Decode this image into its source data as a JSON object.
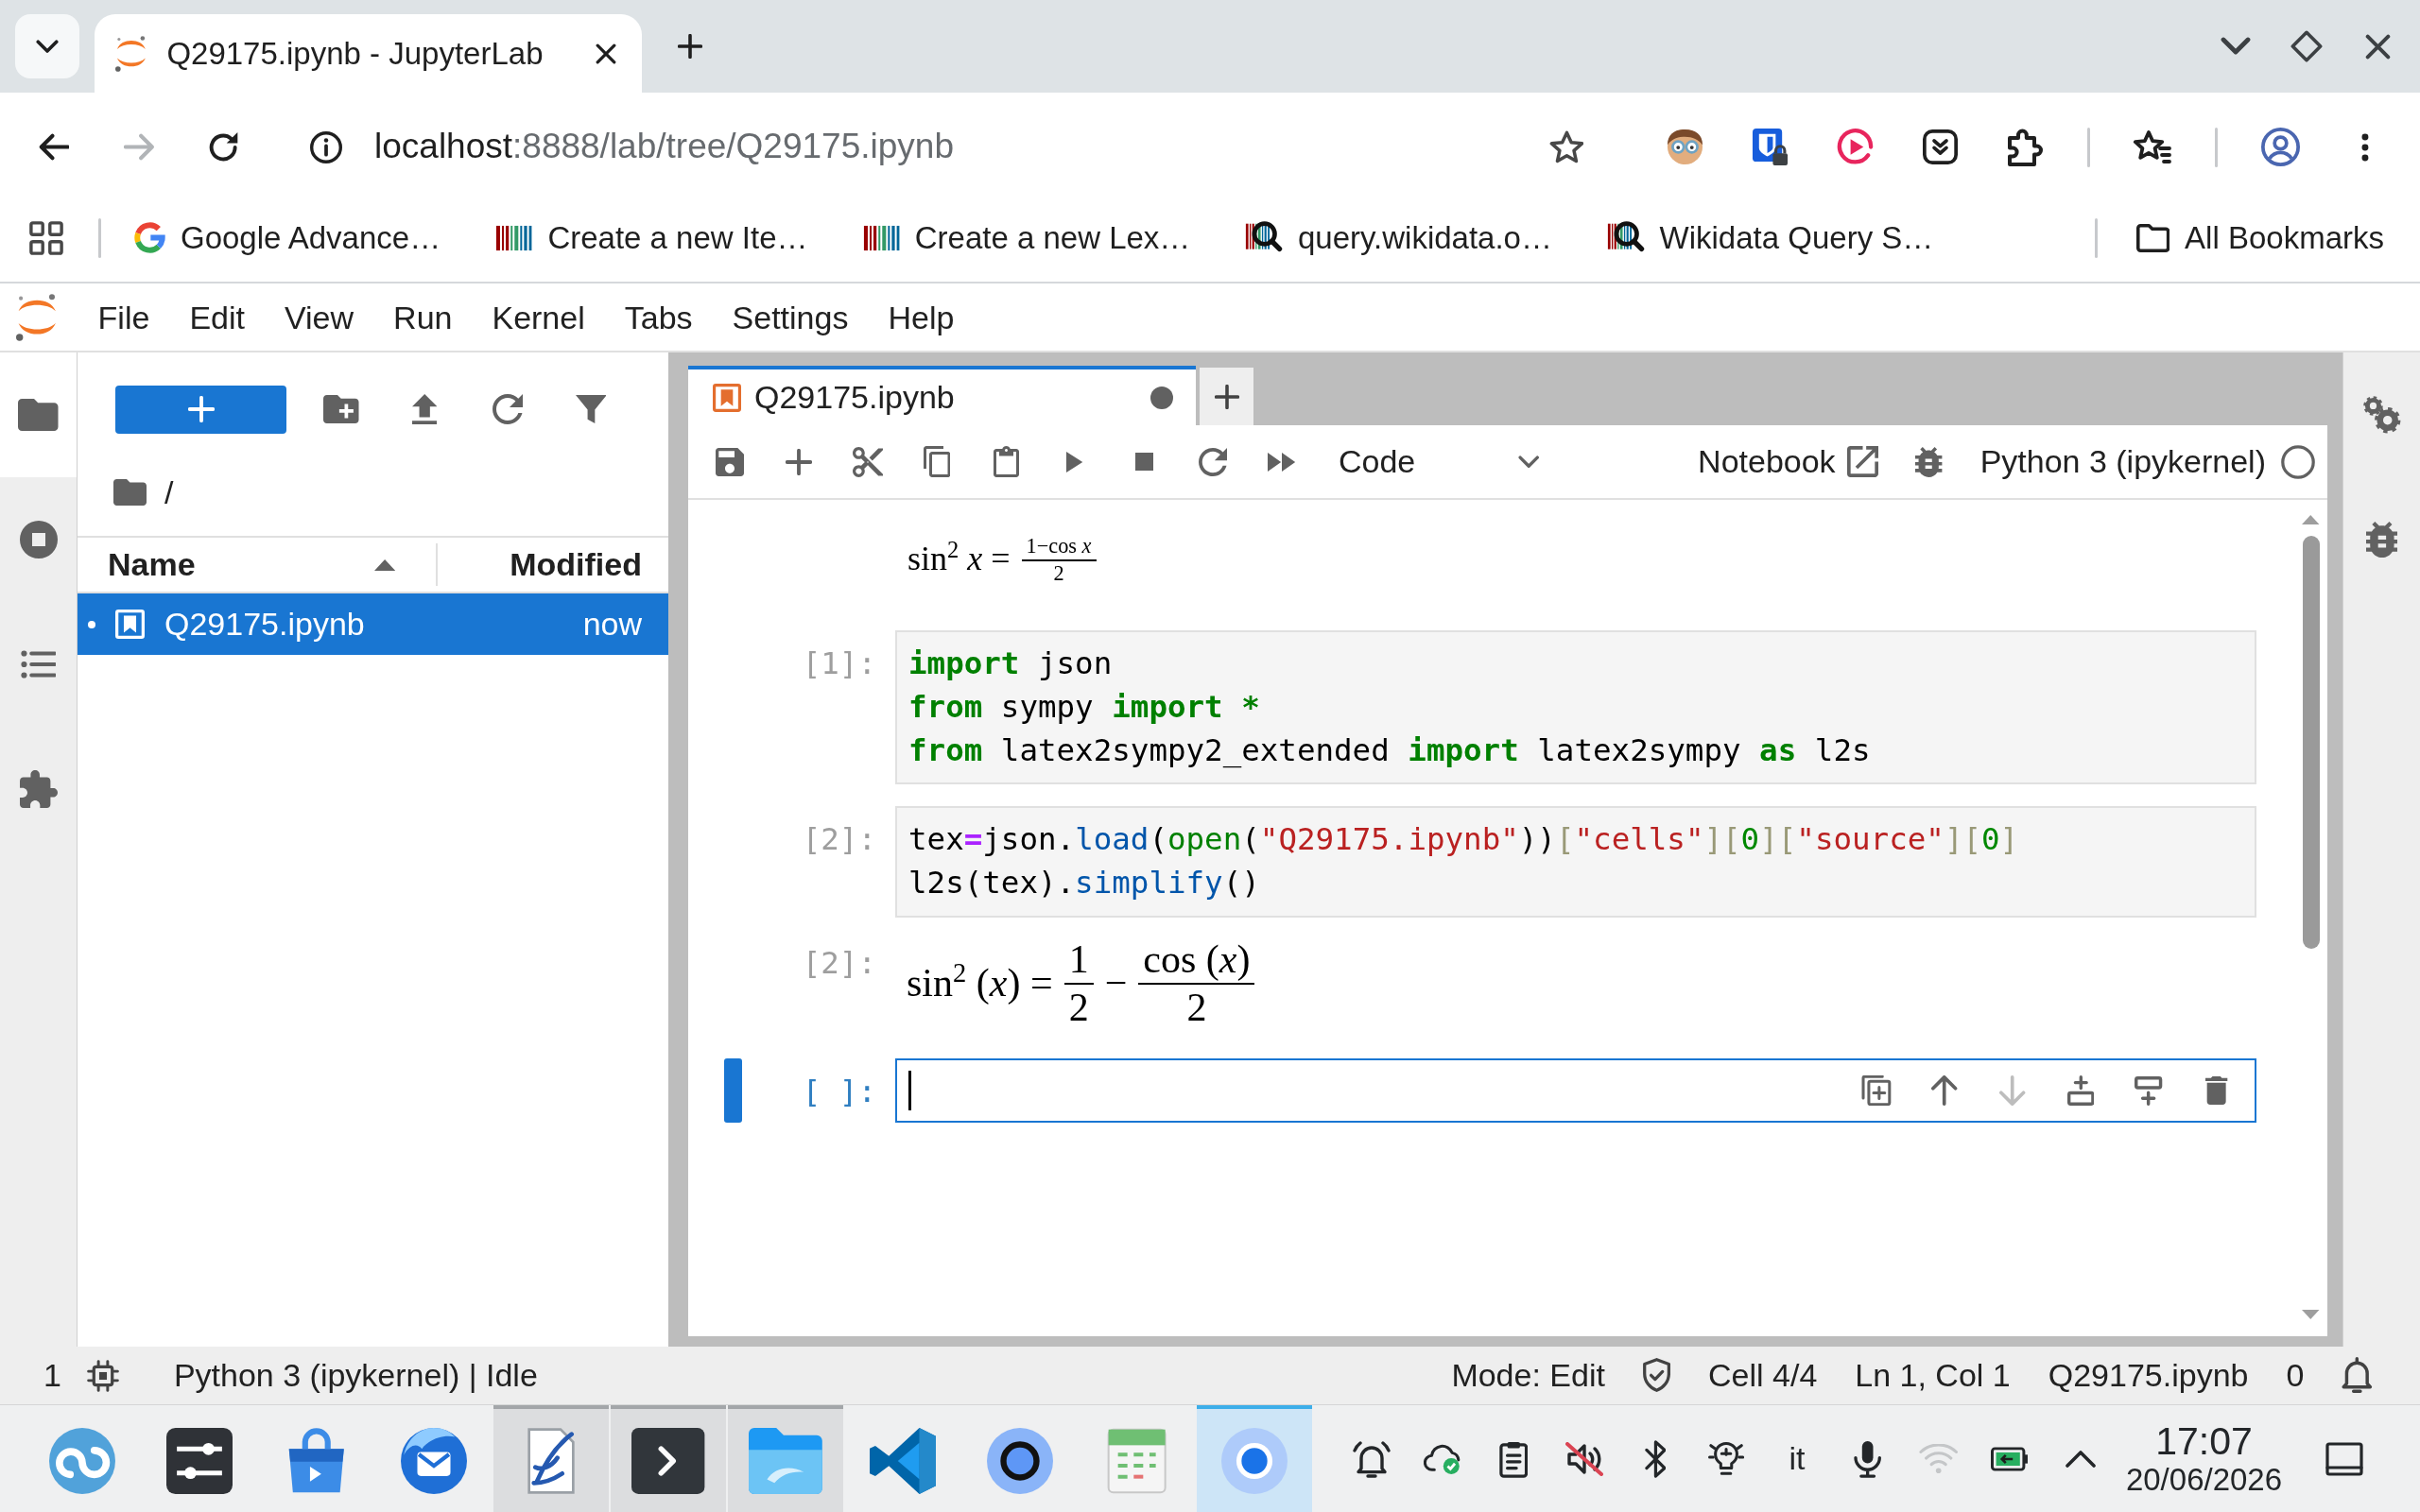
{
  "browser": {
    "tabs": [
      {
        "title": "Q29175.ipynb - JupyterLab",
        "selected": true
      }
    ],
    "nav": [
      {
        "kind": "back",
        "disabled": false
      },
      {
        "kind": "forward",
        "disabled": true
      }
    ],
    "address": {
      "host": "localhost",
      "path": ":8888/lab/tree/Q29175.ipynb"
    },
    "bookmarks": [
      {
        "kind": "google",
        "label": "Google Advance…"
      },
      {
        "kind": "wikidata",
        "label": "Create a new Ite…"
      },
      {
        "kind": "wikidata",
        "label": "Create a new Lex…"
      },
      {
        "kind": "query",
        "label": "query.wikidata.o…"
      },
      {
        "kind": "query",
        "label": "Wikidata Query S…"
      }
    ],
    "all_bookmarks": "All Bookmarks"
  },
  "jupyterlab": {
    "menu": [
      "File",
      "Edit",
      "View",
      "Run",
      "Kernel",
      "Tabs",
      "Settings",
      "Help"
    ],
    "left_sidebar": [
      {
        "kind": "files",
        "selected": true
      },
      {
        "kind": "running",
        "selected": false
      },
      {
        "kind": "toc",
        "selected": false
      },
      {
        "kind": "extensions",
        "selected": false
      }
    ],
    "file_browser": {
      "path": "/",
      "columns": [
        {
          "label": "Name",
          "sorted": true,
          "ascending": true
        },
        {
          "label": "Modified",
          "sorted": false
        }
      ],
      "files": [
        {
          "name": "Q29175.ipynb",
          "modified": "now",
          "selected": true,
          "running": true
        }
      ]
    },
    "notebook": {
      "tabs": [
        {
          "title": "Q29175.ipynb",
          "selected": true,
          "dirty": true
        }
      ],
      "cell_type": "Code",
      "view_button": "Notebook",
      "kernel": {
        "name": "Python 3 (ipykernel)",
        "busy": false
      },
      "cells": [
        {
          "kind": "markdown",
          "active": false,
          "math": [
            {
              "kind": "text",
              "text": "sin$^{2}$ *x* ="
            },
            {
              "kind": "inline_fraction",
              "numerator": "1−cos *x*",
              "denominator": "2"
            }
          ]
        },
        {
          "kind": "code",
          "active": false,
          "prompt": "[1]:",
          "lines": [
            [
              {
                "text": "import",
                "kind": "keyword"
              },
              {
                "text": " json",
                "kind": "plain"
              }
            ],
            [
              {
                "text": "from",
                "kind": "keyword"
              },
              {
                "text": " sympy ",
                "kind": "plain"
              },
              {
                "text": "import",
                "kind": "keyword"
              },
              {
                "text": " *",
                "kind": "keyword"
              }
            ],
            [
              {
                "text": "from",
                "kind": "keyword"
              },
              {
                "text": " latex2sympy2_extended ",
                "kind": "plain"
              },
              {
                "text": "import",
                "kind": "keyword"
              },
              {
                "text": " latex2sympy ",
                "kind": "plain"
              },
              {
                "text": "as",
                "kind": "keyword"
              },
              {
                "text": " l2s",
                "kind": "plain"
              }
            ]
          ]
        },
        {
          "kind": "code",
          "active": false,
          "prompt": "[2]:",
          "lines": [
            [
              {
                "text": "tex",
                "kind": "plain"
              },
              {
                "text": "=",
                "kind": "operator"
              },
              {
                "text": "json.",
                "kind": "plain"
              },
              {
                "text": "load",
                "kind": "property"
              },
              {
                "text": "(",
                "kind": "plain"
              },
              {
                "text": "open",
                "kind": "builtin"
              },
              {
                "text": "(",
                "kind": "plain"
              },
              {
                "text": "\"Q29175.ipynb\"",
                "kind": "string"
              },
              {
                "text": "))",
                "kind": "plain"
              },
              {
                "text": "[",
                "kind": "bracket"
              },
              {
                "text": "\"cells\"",
                "kind": "string"
              },
              {
                "text": "][",
                "kind": "bracket"
              },
              {
                "text": "0",
                "kind": "number"
              },
              {
                "text": "][",
                "kind": "bracket"
              },
              {
                "text": "\"source\"",
                "kind": "string"
              },
              {
                "text": "][",
                "kind": "bracket"
              },
              {
                "text": "0",
                "kind": "number"
              },
              {
                "text": "]",
                "kind": "bracket"
              }
            ],
            [
              {
                "text": "l2s(tex).",
                "kind": "plain"
              },
              {
                "text": "simplify",
                "kind": "property"
              },
              {
                "text": "()",
                "kind": "plain"
              }
            ]
          ],
          "output": {
            "prompt": "[2]:",
            "math": [
              {
                "kind": "text",
                "text": "sin$^{2}$ (*x*) ="
              },
              {
                "kind": "fraction",
                "numerator": "1",
                "denominator": "2"
              },
              {
                "kind": "text",
                "text": "−"
              },
              {
                "kind": "fraction",
                "numerator": "cos (*x*)",
                "denominator": "2"
              }
            ]
          }
        },
        {
          "kind": "code",
          "active": true,
          "prompt": "[ ]:",
          "toolbar": [
            {
              "kind": "duplicate",
              "disabled": false
            },
            {
              "kind": "move_up",
              "disabled": false
            },
            {
              "kind": "move_down",
              "disabled": true
            },
            {
              "kind": "insert_above",
              "disabled": false
            },
            {
              "kind": "insert_below",
              "disabled": false
            },
            {
              "kind": "delete",
              "disabled": false
            }
          ]
        }
      ]
    },
    "right_sidebar": [
      {
        "kind": "property_inspector",
        "selected": false
      },
      {
        "kind": "debugger",
        "selected": false
      }
    ],
    "status_bar": {
      "kernel_count": "1",
      "kernel_status": "Python 3 (ipykernel) | Idle",
      "mode": "Mode: Edit",
      "cell": "Cell 4/4",
      "position": "Ln 1, Col 1",
      "file": "Q29175.ipynb",
      "notifications": "0"
    }
  },
  "taskbar": {
    "apps": [
      {
        "kind": "loop_logo",
        "running": false,
        "selected": false
      },
      {
        "kind": "sliders",
        "running": false,
        "selected": false
      },
      {
        "kind": "bag",
        "running": false,
        "selected": false
      },
      {
        "kind": "mail",
        "running": false,
        "selected": false
      },
      {
        "kind": "quill",
        "running": true,
        "selected": false
      },
      {
        "kind": "terminal",
        "running": true,
        "selected": false
      },
      {
        "kind": "folder",
        "running": true,
        "selected": false
      },
      {
        "kind": "ribbon",
        "running": false,
        "selected": false
      },
      {
        "kind": "ring",
        "running": false,
        "selected": false
      },
      {
        "kind": "calendar",
        "running": false,
        "selected": false
      },
      {
        "kind": "dot_circle",
        "running": true,
        "selected": true
      }
    ],
    "keyboard_layout": "it",
    "volume_muted": true,
    "time": "17:07",
    "date": "20/06/2026"
  }
}
